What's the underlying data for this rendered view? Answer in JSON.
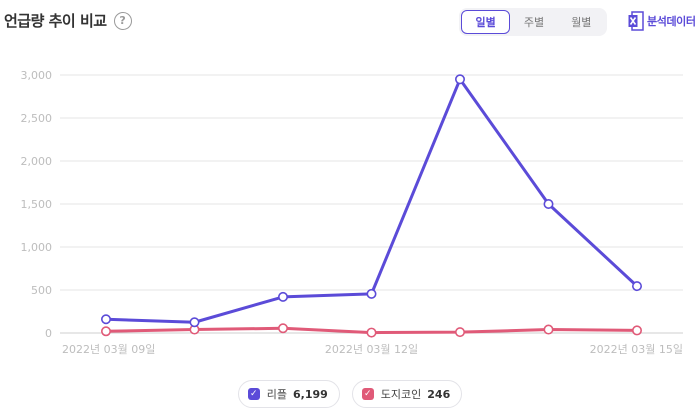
{
  "header": {
    "title": "언급량 추이 비교",
    "help_icon": "question-circle-icon",
    "tabs": [
      {
        "label": "일별",
        "active": true
      },
      {
        "label": "주별",
        "active": false
      },
      {
        "label": "월별",
        "active": false
      }
    ],
    "export_label": "분석데이터",
    "export_icon": "excel-icon"
  },
  "colors": {
    "accent": "#5b4bd8",
    "series1": "#5b4bd8",
    "series2": "#e05a78",
    "grid": "#e6e6e6",
    "axis_text": "#bdbdbd"
  },
  "legend": [
    {
      "name": "리플",
      "value": "6,199"
    },
    {
      "name": "도지코인",
      "value": "246"
    }
  ],
  "chart_data": {
    "type": "line",
    "x": [
      "2022-03-09",
      "2022-03-10",
      "2022-03-11",
      "2022-03-12",
      "2022-03-13",
      "2022-03-14",
      "2022-03-15"
    ],
    "x_tick_labels": [
      "2022년 03월 09일",
      "2022년 03월 12일",
      "2022년 03월 15일"
    ],
    "x_tick_positions": [
      0,
      3,
      6
    ],
    "yticks": [
      "0",
      "500",
      "1,000",
      "1,500",
      "2,000",
      "2,500",
      "3,000"
    ],
    "ylim": [
      0,
      3000
    ],
    "grid": true,
    "legend_position": "bottom-center",
    "series": [
      {
        "name": "리플",
        "values": [
          160,
          125,
          420,
          455,
          2950,
          1500,
          545
        ]
      },
      {
        "name": "도지코인",
        "values": [
          20,
          40,
          55,
          5,
          10,
          40,
          30
        ]
      }
    ]
  }
}
